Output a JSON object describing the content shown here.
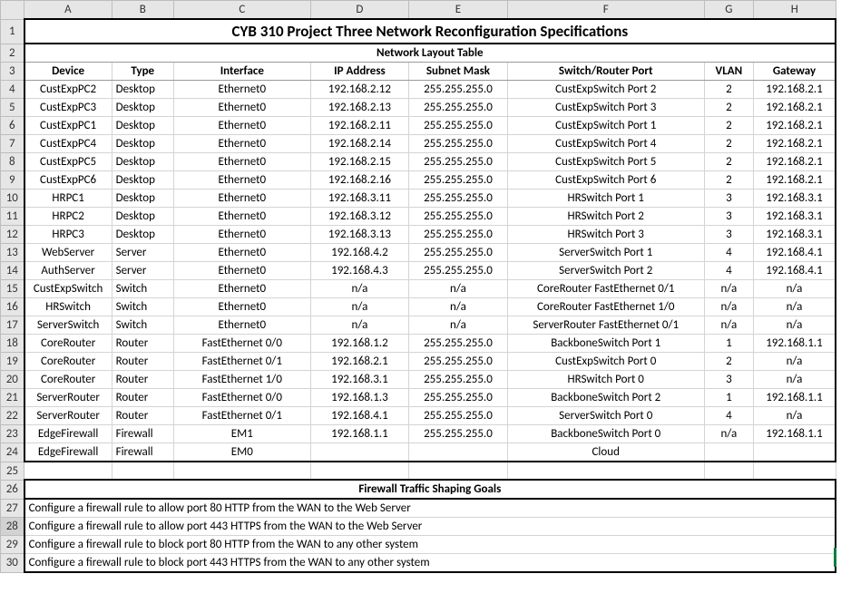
{
  "cols": [
    "A",
    "B",
    "C",
    "D",
    "E",
    "F",
    "G",
    "H"
  ],
  "rows": [
    "1",
    "2",
    "3",
    "4",
    "5",
    "6",
    "7",
    "8",
    "9",
    "10",
    "11",
    "12",
    "13",
    "14",
    "15",
    "16",
    "17",
    "18",
    "19",
    "20",
    "21",
    "22",
    "23",
    "24",
    "25",
    "26",
    "27",
    "28",
    "29",
    "30"
  ],
  "title": "CYB 310 Project Three Network Reconfiguration Specifications",
  "section_title": "Network Layout Table",
  "headers": {
    "device": "Device",
    "type": "Type",
    "interface": "Interface",
    "ip": "IP Address",
    "mask": "Subnet Mask",
    "port": "Switch/Router Port",
    "vlan": "VLAN",
    "gateway": "Gateway"
  },
  "net_rows": [
    {
      "device": "CustExpPC2",
      "type": "Desktop",
      "iface": "Ethernet0",
      "ip": "192.168.2.12",
      "mask": "255.255.255.0",
      "port": "CustExpSwitch Port 2",
      "vlan": "2",
      "gw": "192.168.2.1"
    },
    {
      "device": "CustExpPC3",
      "type": "Desktop",
      "iface": "Ethernet0",
      "ip": "192.168.2.13",
      "mask": "255.255.255.0",
      "port": "CustExpSwitch Port 3",
      "vlan": "2",
      "gw": "192.168.2.1"
    },
    {
      "device": "CustExpPC1",
      "type": "Desktop",
      "iface": "Ethernet0",
      "ip": "192.168.2.11",
      "mask": "255.255.255.0",
      "port": "CustExpSwitch Port 1",
      "vlan": "2",
      "gw": "192.168.2.1"
    },
    {
      "device": "CustExpPC4",
      "type": "Desktop",
      "iface": "Ethernet0",
      "ip": "192.168.2.14",
      "mask": "255.255.255.0",
      "port": "CustExpSwitch Port 4",
      "vlan": "2",
      "gw": "192.168.2.1"
    },
    {
      "device": "CustExpPC5",
      "type": "Desktop",
      "iface": "Ethernet0",
      "ip": "192.168.2.15",
      "mask": "255.255.255.0",
      "port": "CustExpSwitch Port 5",
      "vlan": "2",
      "gw": "192.168.2.1"
    },
    {
      "device": "CustExpPC6",
      "type": "Desktop",
      "iface": "Ethernet0",
      "ip": "192.168.2.16",
      "mask": "255.255.255.0",
      "port": "CustExpSwitch Port 6",
      "vlan": "2",
      "gw": "192.168.2.1"
    },
    {
      "device": "HRPC1",
      "type": "Desktop",
      "iface": "Ethernet0",
      "ip": "192.168.3.11",
      "mask": "255.255.255.0",
      "port": "HRSwitch Port 1",
      "vlan": "3",
      "gw": "192.168.3.1"
    },
    {
      "device": "HRPC2",
      "type": "Desktop",
      "iface": "Ethernet0",
      "ip": "192.168.3.12",
      "mask": "255.255.255.0",
      "port": "HRSwitch Port 2",
      "vlan": "3",
      "gw": "192.168.3.1"
    },
    {
      "device": "HRPC3",
      "type": "Desktop",
      "iface": "Ethernet0",
      "ip": "192.168.3.13",
      "mask": "255.255.255.0",
      "port": "HRSwitch Port 3",
      "vlan": "3",
      "gw": "192.168.3.1"
    },
    {
      "device": "WebServer",
      "type": "Server",
      "iface": "Ethernet0",
      "ip": "192.168.4.2",
      "mask": "255.255.255.0",
      "port": "ServerSwitch Port 1",
      "vlan": "4",
      "gw": "192.168.4.1"
    },
    {
      "device": "AuthServer",
      "type": "Server",
      "iface": "Ethernet0",
      "ip": "192.168.4.3",
      "mask": "255.255.255.0",
      "port": "ServerSwitch Port 2",
      "vlan": "4",
      "gw": "192.168.4.1"
    },
    {
      "device": "CustExpSwitch",
      "type": "Switch",
      "iface": "Ethernet0",
      "ip": "n/a",
      "mask": "n/a",
      "port": "CoreRouter FastEthernet 0/1",
      "vlan": "n/a",
      "gw": "n/a"
    },
    {
      "device": "HRSwitch",
      "type": "Switch",
      "iface": "Ethernet0",
      "ip": "n/a",
      "mask": "n/a",
      "port": "CoreRouter FastEthernet 1/0",
      "vlan": "n/a",
      "gw": "n/a"
    },
    {
      "device": "ServerSwitch",
      "type": "Switch",
      "iface": "Ethernet0",
      "ip": "n/a",
      "mask": "n/a",
      "port": "ServerRouter FastEthernet 0/1",
      "vlan": "n/a",
      "gw": "n/a"
    },
    {
      "device": "CoreRouter",
      "type": "Router",
      "iface": "FastEthernet 0/0",
      "ip": "192.168.1.2",
      "mask": "255.255.255.0",
      "port": "BackboneSwitch Port 1",
      "vlan": "1",
      "gw": "192.168.1.1"
    },
    {
      "device": "CoreRouter",
      "type": "Router",
      "iface": "FastEthernet 0/1",
      "ip": "192.168.2.1",
      "mask": "255.255.255.0",
      "port": "CustExpSwitch Port 0",
      "vlan": "2",
      "gw": "n/a"
    },
    {
      "device": "CoreRouter",
      "type": "Router",
      "iface": "FastEthernet 1/0",
      "ip": "192.168.3.1",
      "mask": "255.255.255.0",
      "port": "HRSwitch Port 0",
      "vlan": "3",
      "gw": "n/a"
    },
    {
      "device": "ServerRouter",
      "type": "Router",
      "iface": "FastEthernet 0/0",
      "ip": "192.168.1.3",
      "mask": "255.255.255.0",
      "port": "BackboneSwitch Port 2",
      "vlan": "1",
      "gw": "192.168.1.1"
    },
    {
      "device": "ServerRouter",
      "type": "Router",
      "iface": "FastEthernet 0/1",
      "ip": "192.168.4.1",
      "mask": "255.255.255.0",
      "port": "ServerSwitch Port 0",
      "vlan": "4",
      "gw": "n/a"
    },
    {
      "device": "EdgeFirewall",
      "type": "Firewall",
      "iface": "EM1",
      "ip": "192.168.1.1",
      "mask": "255.255.255.0",
      "port": "BackboneSwitch Port 0",
      "vlan": "n/a",
      "gw": "192.168.1.1"
    },
    {
      "device": "EdgeFirewall",
      "type": "Firewall",
      "iface": "EM0",
      "ip": "",
      "mask": "",
      "port": "Cloud",
      "vlan": "",
      "gw": ""
    }
  ],
  "firewall_title": "Firewall Traffic Shaping Goals",
  "goals": [
    "Configure a firewall rule to allow port 80 HTTP from the WAN to the Web Server",
    "Configure a firewall rule to allow port 443 HTTPS from the WAN to the Web Server",
    "Configure a firewall rule to block port 80 HTTP from the WAN to any other system",
    "Configure a firewall rule to block port 443 HTTPS from the WAN to any other system"
  ]
}
